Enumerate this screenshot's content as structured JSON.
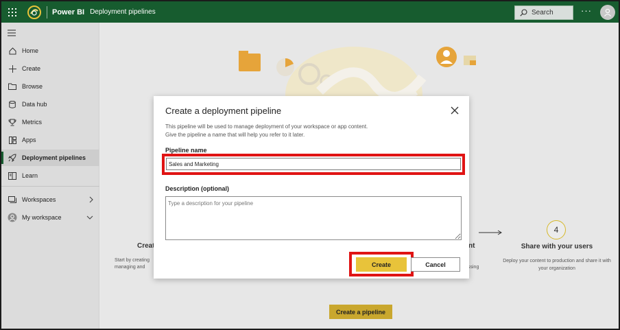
{
  "topbar": {
    "brand": "Power BI",
    "breadcrumb": "Deployment pipelines",
    "search_label": "Search",
    "more_label": "···",
    "colors": {
      "bar": "#175c2f"
    }
  },
  "sidebar": {
    "items": [
      {
        "label": "Home",
        "icon": "home-icon"
      },
      {
        "label": "Create",
        "icon": "plus-icon"
      },
      {
        "label": "Browse",
        "icon": "folder-icon"
      },
      {
        "label": "Data hub",
        "icon": "database-icon"
      },
      {
        "label": "Metrics",
        "icon": "trophy-icon"
      },
      {
        "label": "Apps",
        "icon": "apps-icon"
      },
      {
        "label": "Deployment pipelines",
        "icon": "rocket-icon",
        "active": true
      },
      {
        "label": "Learn",
        "icon": "book-icon"
      },
      {
        "label": "Workspaces",
        "icon": "workspaces-icon"
      },
      {
        "label": "My workspace",
        "icon": "user-circle-icon"
      }
    ]
  },
  "background": {
    "step_create_title": "Creat",
    "step_create_desc_1": "Start by creating",
    "step_create_desc_2": "managing and",
    "step_mid_title_fragment": "nt",
    "step_mid_desc_fragment": "ssing",
    "step4_number": "4",
    "step4_title": "Share with your users",
    "step4_desc": "Deploy your content to production and share it with your organization",
    "create_pipeline_button": "Create a pipeline"
  },
  "dialog": {
    "title": "Create a deployment pipeline",
    "description_line1": "This pipeline will be used to manage deployment of your workspace or app content.",
    "description_line2": "Give the pipeline a name that will help you refer to it later.",
    "name_label": "Pipeline name",
    "name_value": "Sales and Marketing",
    "desc_label": "Description (optional)",
    "desc_placeholder": "Type a description for your pipeline",
    "create_label": "Create",
    "cancel_label": "Cancel",
    "colors": {
      "highlight": "#e01414",
      "primary": "#e8c33a"
    }
  }
}
